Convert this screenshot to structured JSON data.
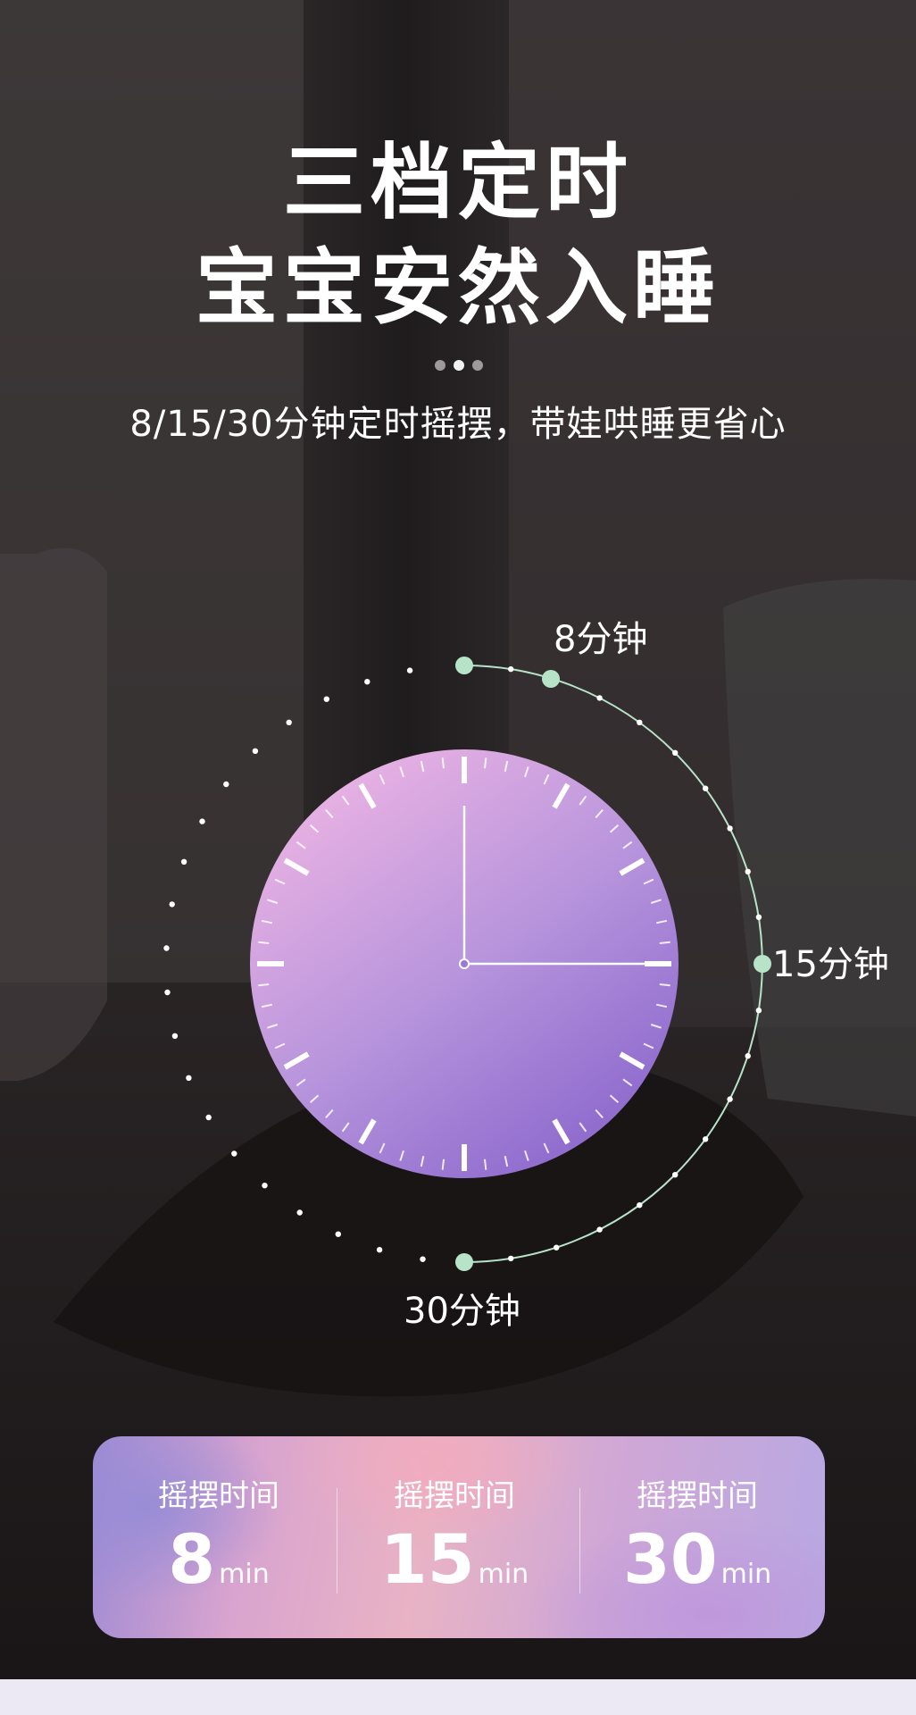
{
  "headline": {
    "line1": "三档定时",
    "line2": "宝宝安然入睡"
  },
  "subtitle": "8/15/30分钟定时摇摆，带娃哄睡更省心",
  "timer_labels": {
    "t8": "8分钟",
    "t15": "15分钟",
    "t30": "30分钟"
  },
  "clock": {
    "hour_hand": "pointing-12",
    "minute_hand": "pointing-3",
    "face_colors": [
      "#e9b2e3",
      "#8a67cc"
    ]
  },
  "panel": {
    "items": [
      {
        "label": "摇摆时间",
        "value": "8",
        "unit": "min"
      },
      {
        "label": "摇摆时间",
        "value": "15",
        "unit": "min"
      },
      {
        "label": "摇摆时间",
        "value": "30",
        "unit": "min"
      }
    ]
  },
  "colors": {
    "accent_mint": "#b7e3c9",
    "dot_white": "#ffffff"
  }
}
